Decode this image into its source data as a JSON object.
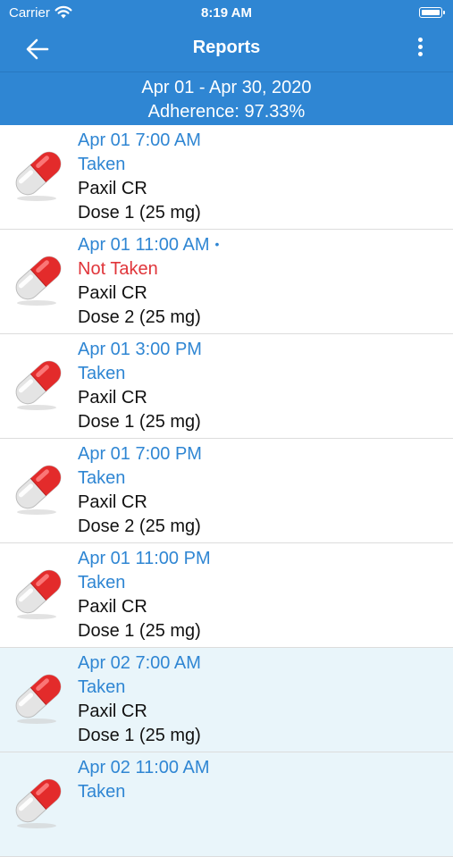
{
  "status": {
    "carrier": "Carrier",
    "time": "8:19 AM"
  },
  "nav": {
    "title": "Reports"
  },
  "summary": {
    "range": "Apr 01 - Apr 30, 2020",
    "adherence": "Adherence: 97.33%"
  },
  "entries": [
    {
      "datetime": "Apr 01 7:00 AM",
      "status": "Taken",
      "drug": "Paxil CR",
      "dose": "Dose 1 (25 mg)",
      "highlight": false,
      "dot": false
    },
    {
      "datetime": "Apr 01 11:00 AM",
      "status": "Not Taken",
      "drug": "Paxil CR",
      "dose": "Dose 2 (25 mg)",
      "highlight": false,
      "dot": true
    },
    {
      "datetime": "Apr 01 3:00 PM",
      "status": "Taken",
      "drug": "Paxil CR",
      "dose": "Dose 1 (25 mg)",
      "highlight": false,
      "dot": false
    },
    {
      "datetime": "Apr 01 7:00 PM",
      "status": "Taken",
      "drug": "Paxil CR",
      "dose": "Dose 2 (25 mg)",
      "highlight": false,
      "dot": false
    },
    {
      "datetime": "Apr 01 11:00 PM",
      "status": "Taken",
      "drug": "Paxil CR",
      "dose": "Dose 1 (25 mg)",
      "highlight": false,
      "dot": false
    },
    {
      "datetime": "Apr 02 7:00 AM",
      "status": "Taken",
      "drug": "Paxil CR",
      "dose": "Dose 1 (25 mg)",
      "highlight": true,
      "dot": false
    },
    {
      "datetime": "Apr 02 11:00 AM",
      "status": "Taken",
      "drug": "",
      "dose": "",
      "highlight": true,
      "dot": false
    }
  ],
  "colors": {
    "accent": "#2f86d3",
    "missed": "#e0353a",
    "highlight_row": "#e9f5fa"
  },
  "icons": {
    "back": "arrow-left-icon",
    "menu": "more-vertical-icon",
    "pill": "capsule-icon"
  }
}
